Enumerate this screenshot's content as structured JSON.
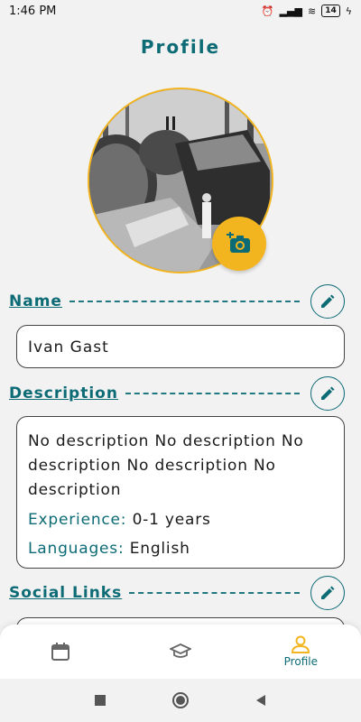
{
  "status_bar": {
    "time": "1:46 PM",
    "battery": "14"
  },
  "header": {
    "title": "Profile"
  },
  "name_section": {
    "label": "Name",
    "value": "Ivan Gast"
  },
  "description_section": {
    "label": "Description",
    "text": "No description No description No description No description No description",
    "experience_label": "Experience:",
    "experience_value": "0-1 years",
    "languages_label": "Languages:",
    "languages_value": "English"
  },
  "social_section": {
    "label": "Social Links"
  },
  "bottom_nav": {
    "items": [
      {
        "icon": "calendar-icon",
        "label": ""
      },
      {
        "icon": "graduation-cap-icon",
        "label": ""
      },
      {
        "icon": "person-icon",
        "label": "Profile",
        "active": true
      }
    ]
  },
  "colors": {
    "accent": "#0c6b75",
    "highlight": "#f3b51f"
  }
}
